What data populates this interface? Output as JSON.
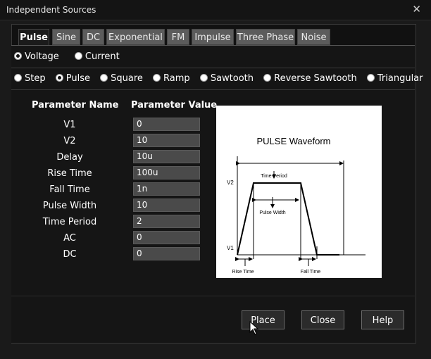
{
  "window": {
    "title": "Independent Sources",
    "close_glyph": "✕"
  },
  "tabs": [
    "Pulse",
    "Sine",
    "DC",
    "Exponential",
    "FM",
    "Impulse",
    "Three Phase",
    "Noise"
  ],
  "active_tab": "Pulse",
  "source_type": {
    "options": [
      "Voltage",
      "Current"
    ],
    "selected": "Voltage"
  },
  "waveform_type": {
    "options": [
      "Step",
      "Pulse",
      "Square",
      "Ramp",
      "Sawtooth",
      "Reverse Sawtooth",
      "Triangular"
    ],
    "selected": "Pulse"
  },
  "params": {
    "header_name": "Parameter Name",
    "header_value": "Parameter Value",
    "rows": [
      {
        "name": "V1",
        "value": "0"
      },
      {
        "name": "V2",
        "value": "10"
      },
      {
        "name": "Delay",
        "value": "10u"
      },
      {
        "name": "Rise Time",
        "value": "100u"
      },
      {
        "name": "Fall Time",
        "value": "1n"
      },
      {
        "name": "Pulse Width",
        "value": "10"
      },
      {
        "name": "Time Period",
        "value": "2"
      },
      {
        "name": "AC",
        "value": "0"
      },
      {
        "name": "DC",
        "value": "0"
      }
    ]
  },
  "diagram": {
    "title": "PULSE Waveform",
    "v2_label": "V2",
    "v1_label": "V1",
    "time_period_label": "Time Period",
    "pulse_width_label": "Pulse Width",
    "rise_time_label": "Rise Time",
    "fall_time_label": "Fall Time"
  },
  "buttons": {
    "place": "Place",
    "close": "Close",
    "help": "Help"
  },
  "colors": {
    "background": "#1a1a1a",
    "tab_inactive": "#5c5c5c",
    "input_bg": "#4a4a4a"
  }
}
